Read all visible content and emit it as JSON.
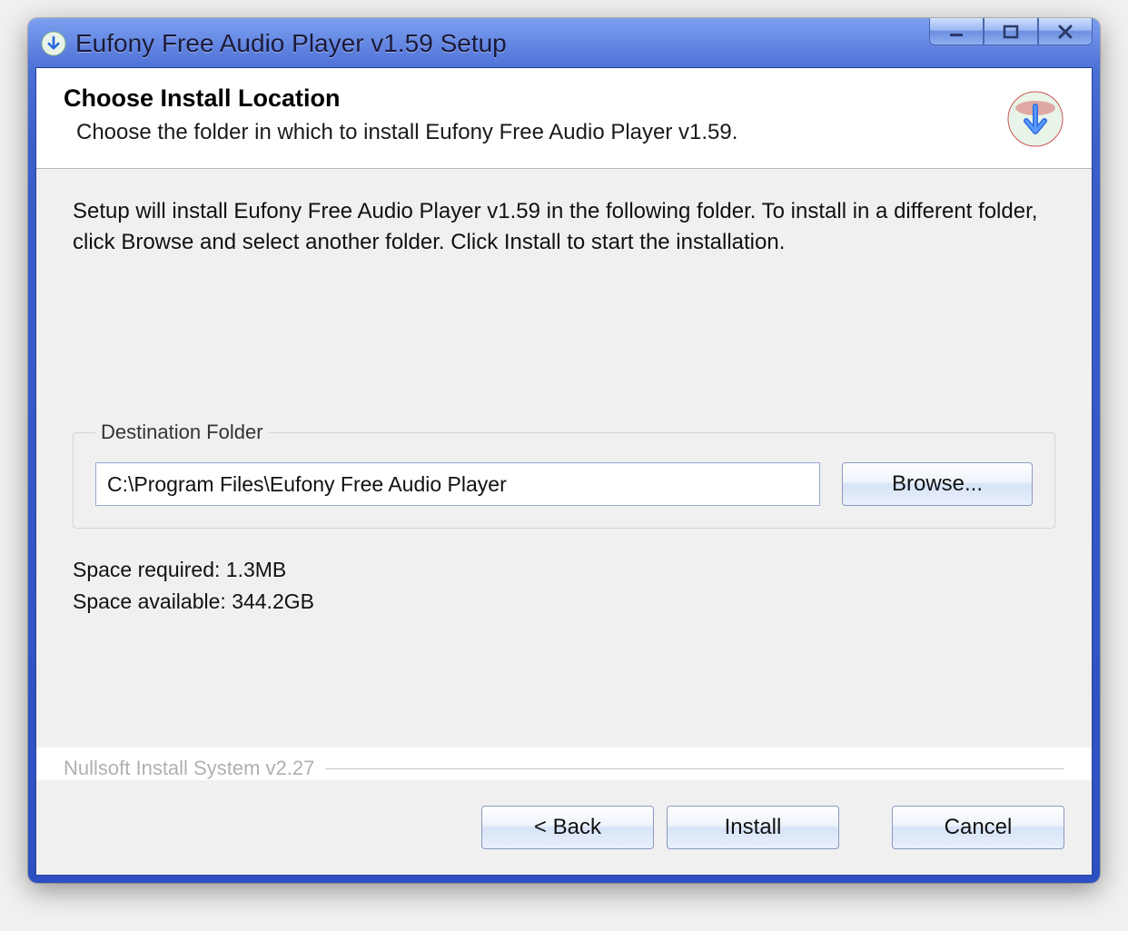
{
  "window": {
    "title": "Eufony Free Audio Player v1.59 Setup"
  },
  "header": {
    "title": "Choose Install Location",
    "subtitle": "Choose the folder in which to install Eufony Free Audio Player v1.59."
  },
  "body": {
    "description": "Setup will install Eufony Free Audio Player v1.59 in the following folder. To install in a different folder, click Browse and select another folder. Click Install to start the installation.",
    "destination_legend": "Destination Folder",
    "destination_path": "C:\\Program Files\\Eufony Free Audio Player",
    "browse_label": "Browse...",
    "space_required_label": "Space required: ",
    "space_required_value": "1.3MB",
    "space_available_label": "Space available: ",
    "space_available_value": "344.2GB"
  },
  "footer": {
    "brand": "Nullsoft Install System v2.27",
    "back_label": "< Back",
    "install_label": "Install",
    "cancel_label": "Cancel"
  }
}
